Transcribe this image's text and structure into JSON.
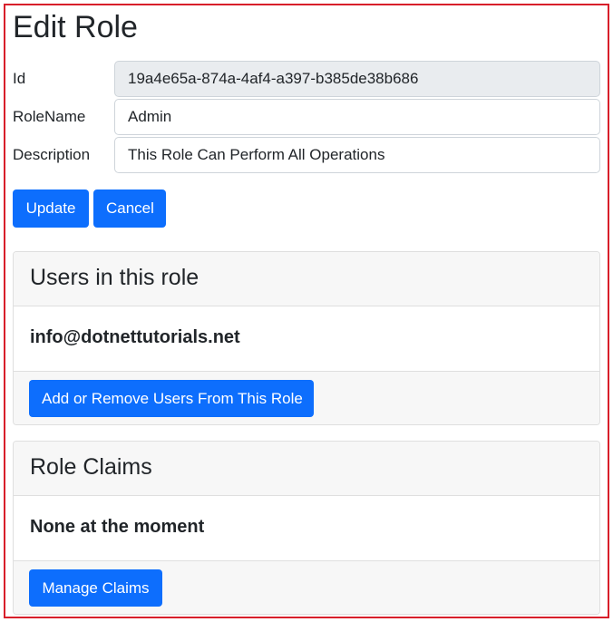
{
  "page": {
    "title": "Edit Role"
  },
  "form": {
    "id_label": "Id",
    "id_value": "19a4e65a-874a-4af4-a397-b385de38b686",
    "rolename_label": "RoleName",
    "rolename_value": "Admin",
    "description_label": "Description",
    "description_value": "This Role Can Perform All Operations",
    "update_label": "Update",
    "cancel_label": "Cancel"
  },
  "users_card": {
    "title": "Users in this role",
    "body": "info@dotnettutorials.net",
    "button_label": "Add or Remove Users From This Role"
  },
  "claims_card": {
    "title": "Role Claims",
    "body": "None at the moment",
    "button_label": "Manage Claims"
  },
  "colors": {
    "primary": "#0d6efd",
    "frame_border": "#d81f2a",
    "readonly_bg": "#e9ecef",
    "card_header_bg": "#f7f7f7"
  }
}
